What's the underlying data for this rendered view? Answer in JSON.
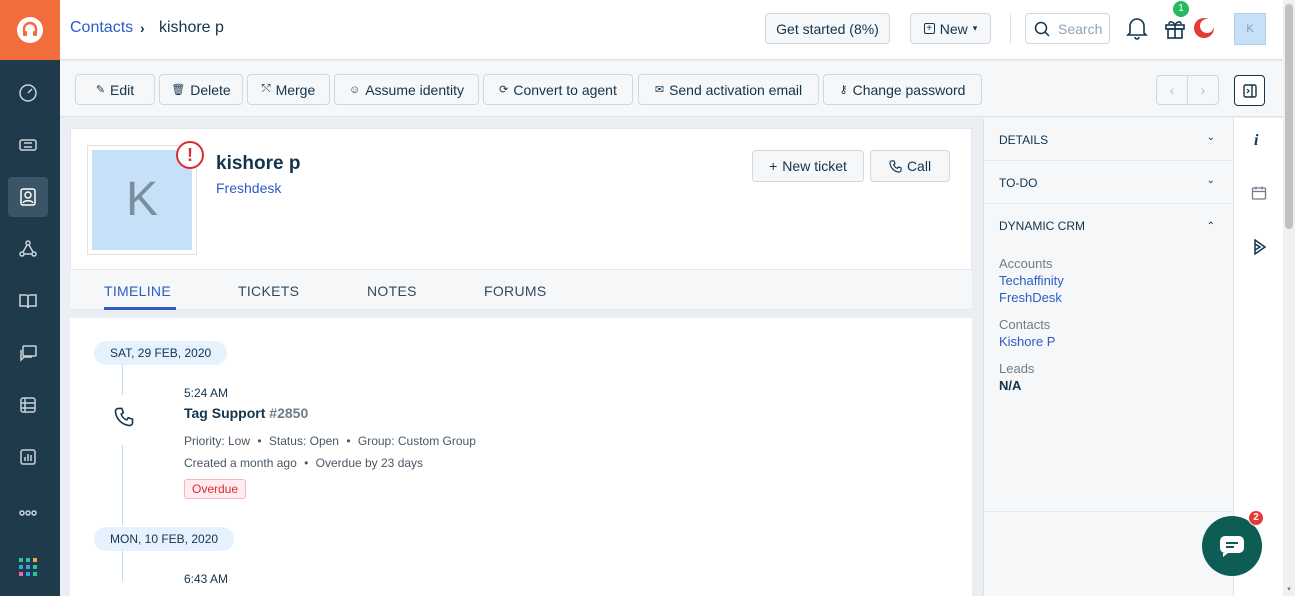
{
  "breadcrumb": {
    "parent": "Contacts",
    "current": "kishore p"
  },
  "header": {
    "get_started": "Get started (8%)",
    "new_label": "New",
    "search_placeholder": "Search",
    "gift_badge": "1",
    "avatar_initial": "K"
  },
  "toolbar": {
    "edit": "Edit",
    "delete": "Delete",
    "merge": "Merge",
    "assume_identity": "Assume identity",
    "convert_to_agent": "Convert to agent",
    "send_activation_email": "Send activation email",
    "change_password": "Change password"
  },
  "contact": {
    "initial": "K",
    "name": "kishore p",
    "company": "Freshdesk",
    "new_ticket": "New ticket",
    "call": "Call"
  },
  "tabs": [
    "TIMELINE",
    "TICKETS",
    "NOTES",
    "FORUMS"
  ],
  "timeline": [
    {
      "date": "SAT, 29 FEB, 2020",
      "time": "5:24 AM",
      "title": "Tag Support",
      "ticket_id": "#2850",
      "priority": "Priority: Low",
      "status": "Status: Open",
      "group": "Group: Custom Group",
      "created": "Created a month ago",
      "overdue_by": "Overdue by 23 days",
      "badge": "Overdue"
    },
    {
      "date": "MON, 10 FEB, 2020",
      "time": "6:43 AM"
    }
  ],
  "right_panel": {
    "details": "DETAILS",
    "todo": "TO-DO",
    "dynamic_crm": "DYNAMIC CRM",
    "accounts_label": "Accounts",
    "accounts": [
      "Techaffinity",
      "FreshDesk"
    ],
    "contacts_label": "Contacts",
    "contacts": [
      "Kishore P"
    ],
    "leads_label": "Leads",
    "leads_value": "N/A"
  },
  "chat_badge": "2",
  "colors": {
    "brand": "#f26d3b",
    "nav": "#1f3a4a",
    "link": "#2c5cc5",
    "overdue": "#d72d30"
  }
}
